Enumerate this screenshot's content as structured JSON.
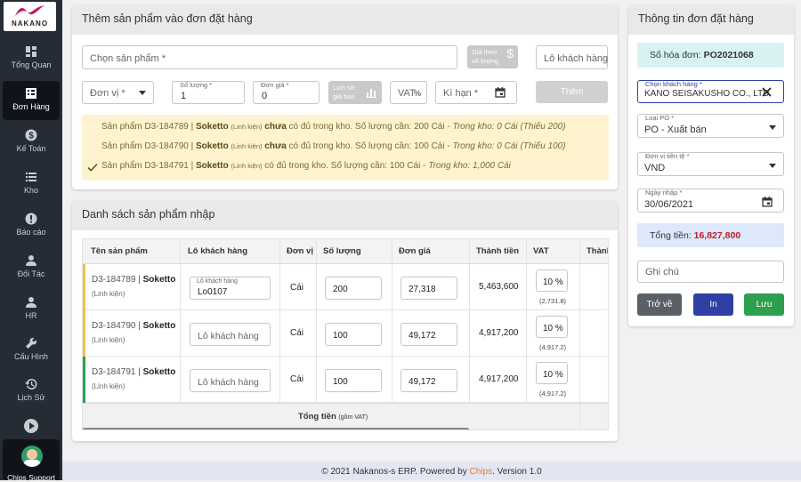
{
  "brand": {
    "logo_text": "NAKANO"
  },
  "sidebar": {
    "items": [
      {
        "label": "Tổng Quan",
        "icon": "dashboard-icon"
      },
      {
        "label": "Đơn Hàng",
        "icon": "orders-icon"
      },
      {
        "label": "Kế Toán",
        "icon": "dollar-icon"
      },
      {
        "label": "Kho",
        "icon": "warehouse-list-icon"
      },
      {
        "label": "Báo cáo",
        "icon": "alert-icon"
      },
      {
        "label": "Đối Tác",
        "icon": "person-icon"
      },
      {
        "label": "HR",
        "icon": "person-icon"
      },
      {
        "label": "Cấu Hình",
        "icon": "wrench-icon"
      },
      {
        "label": "Lịch Sử",
        "icon": "history-icon"
      }
    ],
    "support_label": "Chips Support"
  },
  "add_product": {
    "title": "Thêm sản phẩm vào đơn đặt hàng",
    "product_placeholder": "Chọn sản phẩm *",
    "price_by_qty": "Giá theo số lượng",
    "customer_lot": "Lô khách hàng",
    "unit_placeholder": "Đơn vị *",
    "qty_label": "Số lượng *",
    "qty_value": "1",
    "price_label": "Đơn giá *",
    "price_value": "0",
    "sales_history": "Lịch sử giá bán",
    "vat_label": "VAT",
    "period_placeholder": "Kì hạn *",
    "add_button": "Thêm"
  },
  "warnings": [
    {
      "pre": "Sản phẩm D3-184789 |",
      "brand": "Soketto",
      "cat": "(Linh kiện)",
      "status": "chưa",
      "text": "có đủ trong kho. Số lượng cần: 200 Cái -",
      "stock": "Trong kho: 0 Cái",
      "short": "(Thiếu 200)"
    },
    {
      "pre": "Sản phẩm D3-184790 |",
      "brand": "Soketto",
      "cat": "(Linh kiện)",
      "status": "chưa",
      "text": "có đủ trong kho. Số lượng cần: 100 Cái -",
      "stock": "Trong kho: 0 Cái",
      "short": "(Thiếu 100)"
    },
    {
      "pre": "Sản phẩm D3-184791 |",
      "brand": "Soketto",
      "cat": "(Linh kiện)",
      "status": "",
      "text": "có đủ trong kho. Số lượng cần: 100 Cái -",
      "stock": "Trong kho: 1,000 Cái",
      "short": ""
    }
  ],
  "product_list": {
    "title": "Danh sách sản phẩm nhập",
    "columns": [
      "Tên sản phẩm",
      "Lô khách hàng",
      "Đơn vị",
      "Số lượng",
      "Đơn giá",
      "Thành tiền",
      "VAT",
      "Thành"
    ],
    "lot_label": "Lô khách hàng",
    "rows": [
      {
        "code": "D3-184789 |",
        "brand": "Soketto",
        "cat": "(Linh kiện)",
        "lot": "Lo0107",
        "unit": "Cái",
        "qty": "200",
        "price": "27,318",
        "total": "5,463,600",
        "vat": "10 %",
        "vat_amount": "(2,731.8)",
        "status_color": "#f0c24b"
      },
      {
        "code": "D3-184790 |",
        "brand": "Soketto",
        "cat": "(Linh kiện)",
        "lot": "",
        "unit": "Cái",
        "qty": "100",
        "price": "49,172",
        "total": "4,917,200",
        "vat": "10 %",
        "vat_amount": "(4,917.2)",
        "status_color": "#f0c24b"
      },
      {
        "code": "D3-184791 |",
        "brand": "Soketto",
        "cat": "(Linh kiện)",
        "lot": "",
        "unit": "Cái",
        "qty": "100",
        "price": "49,172",
        "total": "4,917,200",
        "vat": "10 %",
        "vat_amount": "(4,917.2)",
        "status_color": "#2e9e4f"
      }
    ],
    "footer_label": "Tổng tiền",
    "footer_sub": "(gồm VAT)"
  },
  "order_info": {
    "title": "Thông tin đơn đặt hàng",
    "invoice_label": "Số hóa đơn:",
    "invoice_no": "PO2021068",
    "customer_label": "Chọn khách hàng *",
    "customer_value": "KANO SEISAKUSHO CO., LTD",
    "po_type_label": "Loại PO *",
    "po_type_value": "PO - Xuất bán",
    "currency_label": "Đơn vị tiền tệ *",
    "currency_value": "VND",
    "date_label": "Ngày nhập *",
    "date_value": "30/06/2021",
    "total_label": "Tổng tiền:",
    "total_value": "16,827,800",
    "note_placeholder": "Ghi chú",
    "back_button": "Trở về",
    "print_button": "In",
    "save_button": "Lưu"
  },
  "footer": {
    "text": "© 2021 Nakanos-s ERP. Powered by",
    "link": "Chips",
    "version": ". Version 1.0"
  },
  "colors": {
    "sidebar": "#262c35",
    "primary": "#2f3fa3",
    "success": "#2e9e4f",
    "danger": "#c0202a",
    "info": "#d8f1f3"
  }
}
